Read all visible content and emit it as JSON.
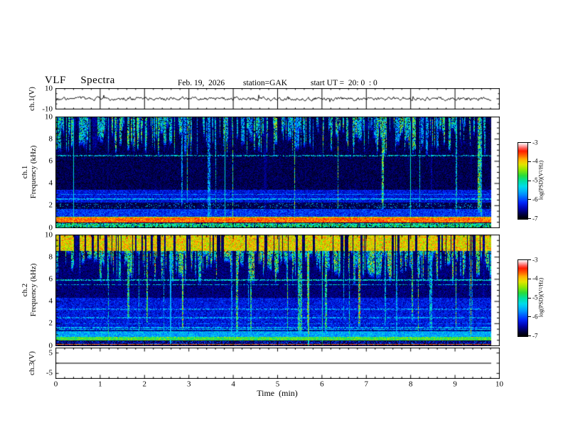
{
  "header": {
    "title": "VLF  Spectra",
    "date": "Feb. 19,  2026",
    "station": "station=GAK",
    "start_ut": "start UT =  20: 0  : 0"
  },
  "xaxis": {
    "label": "Time  (min)",
    "min": 0,
    "max": 10,
    "major_ticks": [
      0,
      1,
      2,
      3,
      4,
      5,
      6,
      7,
      8,
      9,
      10
    ],
    "minor_step": 0.2,
    "data_end_min": 9.82
  },
  "colorbar": {
    "label": "log(PSD)(V²/Hz)",
    "ticks": [
      -3,
      -4,
      -5,
      -6,
      -7
    ],
    "colormap_stops": [
      [
        0.0,
        "#000000"
      ],
      [
        0.05,
        "#000030"
      ],
      [
        0.13,
        "#0000a8"
      ],
      [
        0.22,
        "#0028ff"
      ],
      [
        0.33,
        "#0096ff"
      ],
      [
        0.42,
        "#00dcf0"
      ],
      [
        0.5,
        "#00e0a0"
      ],
      [
        0.57,
        "#28dc3c"
      ],
      [
        0.65,
        "#96e800"
      ],
      [
        0.72,
        "#e8e400"
      ],
      [
        0.78,
        "#ffb400"
      ],
      [
        0.84,
        "#ff5a00"
      ],
      [
        0.9,
        "#ff1400"
      ],
      [
        0.94,
        "#ff7878"
      ],
      [
        0.97,
        "#ffbcbc"
      ],
      [
        1.0,
        "#ffffff"
      ]
    ]
  },
  "chart_data": [
    {
      "id": "wave",
      "type": "line",
      "ylabel": "ch.1(V)",
      "ylim": [
        -10,
        10
      ],
      "yticks_labeled": [
        10,
        -10
      ],
      "yticks_major": [
        10,
        0,
        -10
      ],
      "yticks_minor": [
        5,
        -5
      ],
      "line_color": "#000000",
      "seed": 9,
      "spike_prob": 0.012,
      "x_gridlines": true,
      "description": "ch.1 broadband voltage waveform: noisy trace fluctuating about ±2 V around 0 V with occasional ±5 V impulsive spikes, drawn from 0 to 9.82 min; vertical gridlines at each minute"
    },
    {
      "id": "spec1",
      "type": "heatmap",
      "ylabel_lines": [
        "ch.1",
        "Frequency (kHz)"
      ],
      "ylim": [
        0,
        10
      ],
      "yticks_labeled": [
        0,
        2,
        4,
        6,
        8,
        10
      ],
      "y_minor_step": 0.5,
      "seed": 42,
      "streaks": {
        "prob": 0.55,
        "v_min": 0.45,
        "v_max": 0.8,
        "depth_min": 1.2,
        "depth_max": 3.8,
        "deep_prob": 0.05,
        "pair_prob": 0.35
      },
      "full_line_prob": 0.012,
      "bands": [
        {
          "f0": 0.0,
          "f1": 0.45,
          "v0": 0.4,
          "v1": 0.62,
          "p": 0.8
        },
        {
          "f0": 0.5,
          "f1": 0.95,
          "v0": 0.74,
          "v1": 0.92
        },
        {
          "f0": 1.05,
          "f1": 1.75,
          "v0": 0.13,
          "v1": 0.32
        },
        {
          "f0": 1.8,
          "f1": 2.25,
          "v0": 0.28,
          "v1": 0.48,
          "p": 0.1
        },
        {
          "f0": 2.3,
          "f1": 3.45,
          "v0": 0.1,
          "v1": 0.26
        }
      ],
      "lines": [
        {
          "f": 6.5,
          "hw": 0.06,
          "v0": 0.36,
          "v1": 0.5,
          "p": 0.55
        },
        {
          "f": 2.62,
          "hw": 0.05,
          "v0": 0.3,
          "v1": 0.45,
          "p": 0.8
        },
        {
          "f": 3.02,
          "hw": 0.04,
          "v0": 0.26,
          "v1": 0.4,
          "p": 0.7
        },
        {
          "f": 1.0,
          "hw": 0.04,
          "v0": 0.58,
          "v1": 0.74
        },
        {
          "f": 0.7,
          "hw": 0.03,
          "v0": 0.86,
          "v1": 0.94
        }
      ],
      "description": "ch.1 VLF spectrogram 0-10 kHz vs 0-9.82 min: dense green/cyan sferic streaks above ~6 kHz, dark 3.5-6 kHz background, diffuse blue band 2.3-3.4 kHz, noisy blue band 1.0-1.75 kHz, intense red/orange hum band 0.5-0.95 kHz, patchy green/cyan band below 0.45 kHz, patchy cyan line near 6.5 kHz"
    },
    {
      "id": "spec2",
      "type": "heatmap",
      "ylabel_lines": [
        "ch.2",
        "Frequency (kHz)"
      ],
      "ylim": [
        0,
        10
      ],
      "yticks_labeled": [
        0,
        2,
        4,
        6,
        8,
        10
      ],
      "y_minor_step": 0.5,
      "seed": 1337,
      "streaks": {
        "prob": 0.72,
        "v_min": 0.48,
        "v_max": 0.88,
        "depth_min": 1.5,
        "depth_max": 4.8,
        "deep_prob": 0.12,
        "pair_prob": 0.4
      },
      "top_hot": {
        "f_min": 8.55,
        "v_min": 0.6,
        "v_max": 0.84,
        "speck_prob": 0.04,
        "speck_v": 0.91
      },
      "full_line_prob": 0.015,
      "bands": [
        {
          "f0": 0.5,
          "f1": 0.8,
          "v0": 0.48,
          "v1": 0.68
        },
        {
          "f0": 0.85,
          "f1": 1.35,
          "v0": 0.26,
          "v1": 0.44
        },
        {
          "f0": 0.0,
          "f1": 0.45,
          "v0": 0.06,
          "v1": 0.32,
          "p": 0.5
        },
        {
          "f0": 1.4,
          "f1": 4.3,
          "v0": 0.1,
          "v1": 0.27
        },
        {
          "f0": 4.3,
          "f1": 8.0,
          "v0": 0.05,
          "v1": 0.15,
          "p": 0.7
        }
      ],
      "lines": [
        {
          "f": 0.18,
          "hw": 0.035,
          "v0": 0.78,
          "v1": 0.88
        },
        {
          "f": 1.5,
          "hw": 0.05,
          "v0": 0.36,
          "v1": 0.5,
          "p": 0.8
        },
        {
          "f": 1.65,
          "hw": 0.04,
          "v0": 0.34,
          "v1": 0.46,
          "p": 0.7
        },
        {
          "f": 5.92,
          "hw": 0.05,
          "v0": 0.38,
          "v1": 0.52,
          "p": 0.75
        },
        {
          "f": 5.5,
          "hw": 0.05,
          "v0": 0.34,
          "v1": 0.48,
          "p": 0.6
        },
        {
          "f": 3.3,
          "hw": 0.05,
          "v0": 0.28,
          "v1": 0.42,
          "p": 0.6
        },
        {
          "f": 2.55,
          "hw": 0.05,
          "v0": 0.3,
          "v1": 0.45,
          "p": 0.65
        },
        {
          "f": 2.0,
          "hw": 0.04,
          "v0": 0.26,
          "v1": 0.4,
          "p": 0.5
        }
      ],
      "description": "ch.2 VLF spectrogram 0-10 kHz vs 0-9.82 min: very dense yellow/green streaks with red specks above ~8.5 kHz, streaks reaching deeper than ch.1, patchy cyan lines near 5.5-5.9 kHz, blue checkered 1.4-4.3 kHz region, bright green band 0.5-0.8 kHz, red line near 0.18 kHz"
    },
    {
      "id": "ch3",
      "type": "line",
      "ylabel": "ch.3(V)",
      "ylim": [
        -5,
        5
      ],
      "ylim_draw": [
        -7.5,
        7.5
      ],
      "yticks_labeled": [
        5,
        -5
      ],
      "yticks_major": [
        5,
        0,
        -5
      ],
      "value_v": 0,
      "line_color": "#4a4a4a",
      "x_gridlines": false,
      "description": "ch.3 voltage: flat gray line at 0 V from 0 to 9.82 min"
    }
  ]
}
